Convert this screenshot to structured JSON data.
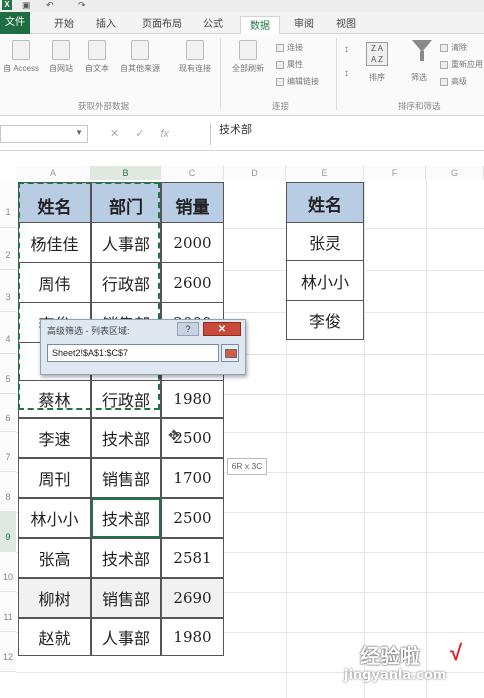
{
  "qat": {
    "excel_badge": "X"
  },
  "tabs": [
    "文件",
    "开始",
    "插入",
    "页面布局",
    "公式",
    "数据",
    "审阅",
    "视图"
  ],
  "ribbon": {
    "get_external": [
      "自 Access",
      "自网站",
      "自文本",
      "自其他来源",
      "现有连接"
    ],
    "group_external": "获取外部数据",
    "refresh_all": "全部刷新",
    "conn_items": [
      "连接",
      "属性",
      "编辑链接"
    ],
    "group_conn": "连接",
    "sort": "排序",
    "sort_icon_text": "Z A\nA Z",
    "filter": "筛选",
    "filter_items": [
      "清除",
      "重新应用",
      "高级"
    ],
    "group_sort": "排序和筛选"
  },
  "formula_bar": {
    "name_box": "",
    "formula": "技术部",
    "cancel": "✕",
    "enter": "✓",
    "fx": "fx"
  },
  "columns": [
    "A",
    "B",
    "C",
    "D",
    "E",
    "F",
    "G"
  ],
  "rows": [
    "1",
    "2",
    "3",
    "4",
    "5",
    "6",
    "7",
    "8",
    "9",
    "10",
    "11",
    "12"
  ],
  "table": {
    "headers": [
      "姓名",
      "部门",
      "销量"
    ],
    "rows": [
      [
        "杨佳佳",
        "人事部",
        "2000"
      ],
      [
        "周伟",
        "行政部",
        "2600"
      ],
      [
        "李俊",
        "销售部",
        "2000"
      ],
      [
        "",
        "",
        ""
      ],
      [
        "蔡林",
        "行政部",
        "1980"
      ],
      [
        "李速",
        "技术部",
        "2500"
      ],
      [
        "周刊",
        "销售部",
        "1700"
      ],
      [
        "林小小",
        "技术部",
        "2500"
      ],
      [
        "张高",
        "技术部",
        "2581"
      ],
      [
        "柳树",
        "销售部",
        "2690"
      ],
      [
        "赵就",
        "人事部",
        "1980"
      ]
    ]
  },
  "criteria": {
    "header": "姓名",
    "values": [
      "张灵",
      "林小小",
      "李俊"
    ]
  },
  "dialog": {
    "title": "高级筛选 - 列表区域:",
    "help": "?",
    "close": "✕",
    "input_value": "Sheet2!$A$1:$C$7"
  },
  "size_tip": "6R x 3C",
  "watermark": {
    "line1": "经验啦",
    "line2": "jingyanla.com",
    "check": "√"
  }
}
